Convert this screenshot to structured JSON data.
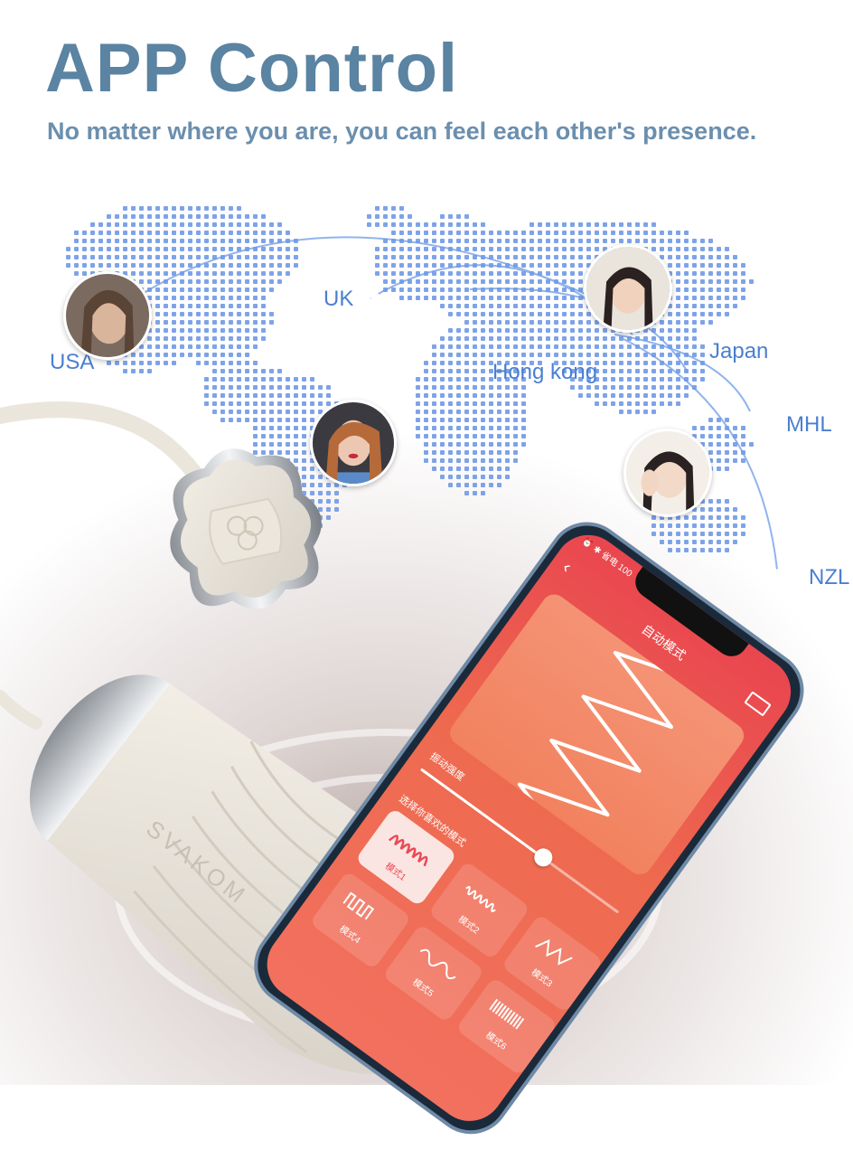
{
  "header": {
    "title": "APP Control",
    "subtitle": "No matter where you are, you can feel each other's presence."
  },
  "map": {
    "locations": [
      {
        "name": "USA"
      },
      {
        "name": "UK"
      },
      {
        "name": "Hong kong"
      },
      {
        "name": "Japan"
      },
      {
        "name": "MHL"
      },
      {
        "name": "NZL"
      }
    ]
  },
  "product": {
    "brand": "SVAKOM"
  },
  "phone": {
    "status": "⏰ ✱ 省电 100",
    "app_title": "自动模式",
    "slider_label": "振动强度",
    "slider_value": 0.62,
    "section_label": "选择你喜欢的模式",
    "modes": [
      {
        "label": "模式1",
        "active": true
      },
      {
        "label": "模式2",
        "active": false
      },
      {
        "label": "模式3",
        "active": false
      },
      {
        "label": "模式4",
        "active": false
      },
      {
        "label": "模式5",
        "active": false
      },
      {
        "label": "模式6",
        "active": false
      }
    ]
  },
  "colors": {
    "title": "#5b83a2",
    "city": "#4a7fd0",
    "map_dots": "#7ea3e8",
    "app_gradient_top": "#e9464f",
    "app_gradient_bottom": "#f2705e"
  }
}
